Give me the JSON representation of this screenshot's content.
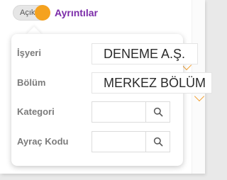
{
  "toggle": {
    "state_label": "Açık",
    "is_on": true,
    "accent_color": "#f5a21f"
  },
  "details_link": {
    "label": "Ayrıntılar",
    "color": "#7b2ba8"
  },
  "popup": {
    "fields": [
      {
        "label": "İşyeri",
        "value": "DENEME A.Ş.",
        "type": "readonly"
      },
      {
        "label": "Bölüm",
        "value": "MERKEZ BÖLÜM",
        "type": "readonly"
      },
      {
        "label": "Kategori",
        "value": "",
        "type": "search",
        "button_icon": "search-icon"
      },
      {
        "label": "Ayraç Kodu",
        "value": "",
        "type": "search",
        "button_icon": "search-icon"
      }
    ]
  },
  "background": {
    "chevron_icon": "chevron-down-icon",
    "chevron_color": "#f2a33a"
  }
}
